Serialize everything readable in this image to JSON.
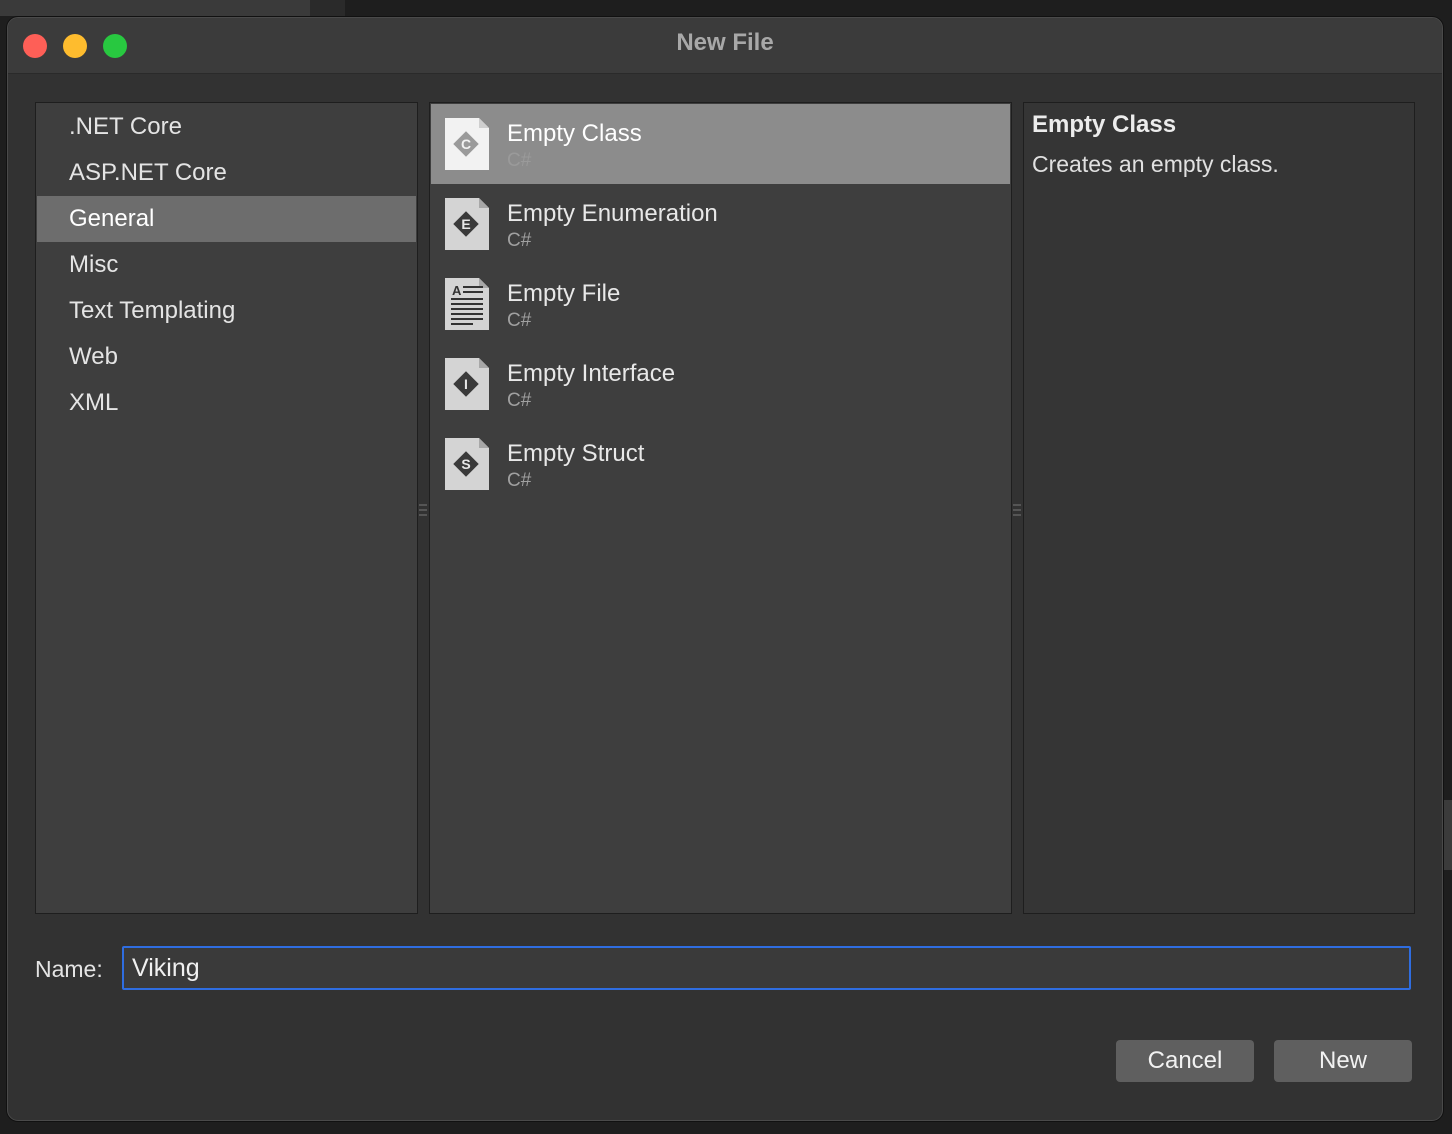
{
  "window": {
    "title": "New File"
  },
  "categories": {
    "items": [
      {
        "label": ".NET Core"
      },
      {
        "label": "ASP.NET Core"
      },
      {
        "label": "General"
      },
      {
        "label": "Misc"
      },
      {
        "label": "Text Templating"
      },
      {
        "label": "Web"
      },
      {
        "label": "XML"
      }
    ],
    "selected": "General"
  },
  "templates": {
    "items": [
      {
        "name": "Empty Class",
        "lang": "C#",
        "icon": "class-file-icon",
        "glyph": "C"
      },
      {
        "name": "Empty Enumeration",
        "lang": "C#",
        "icon": "enum-file-icon",
        "glyph": "E"
      },
      {
        "name": "Empty File",
        "lang": "C#",
        "icon": "text-file-icon",
        "glyph": "A"
      },
      {
        "name": "Empty Interface",
        "lang": "C#",
        "icon": "interface-file-icon",
        "glyph": "I"
      },
      {
        "name": "Empty Struct",
        "lang": "C#",
        "icon": "struct-file-icon",
        "glyph": "S"
      }
    ],
    "selected": "Empty Class"
  },
  "description": {
    "title": "Empty Class",
    "text": "Creates an empty class."
  },
  "name_field": {
    "label": "Name:",
    "value": "Viking"
  },
  "buttons": {
    "cancel": "Cancel",
    "new": "New"
  },
  "colors": {
    "accent": "#2f6de0",
    "close": "#fe5f57",
    "minimize": "#febc2e",
    "maximize": "#28c840"
  }
}
